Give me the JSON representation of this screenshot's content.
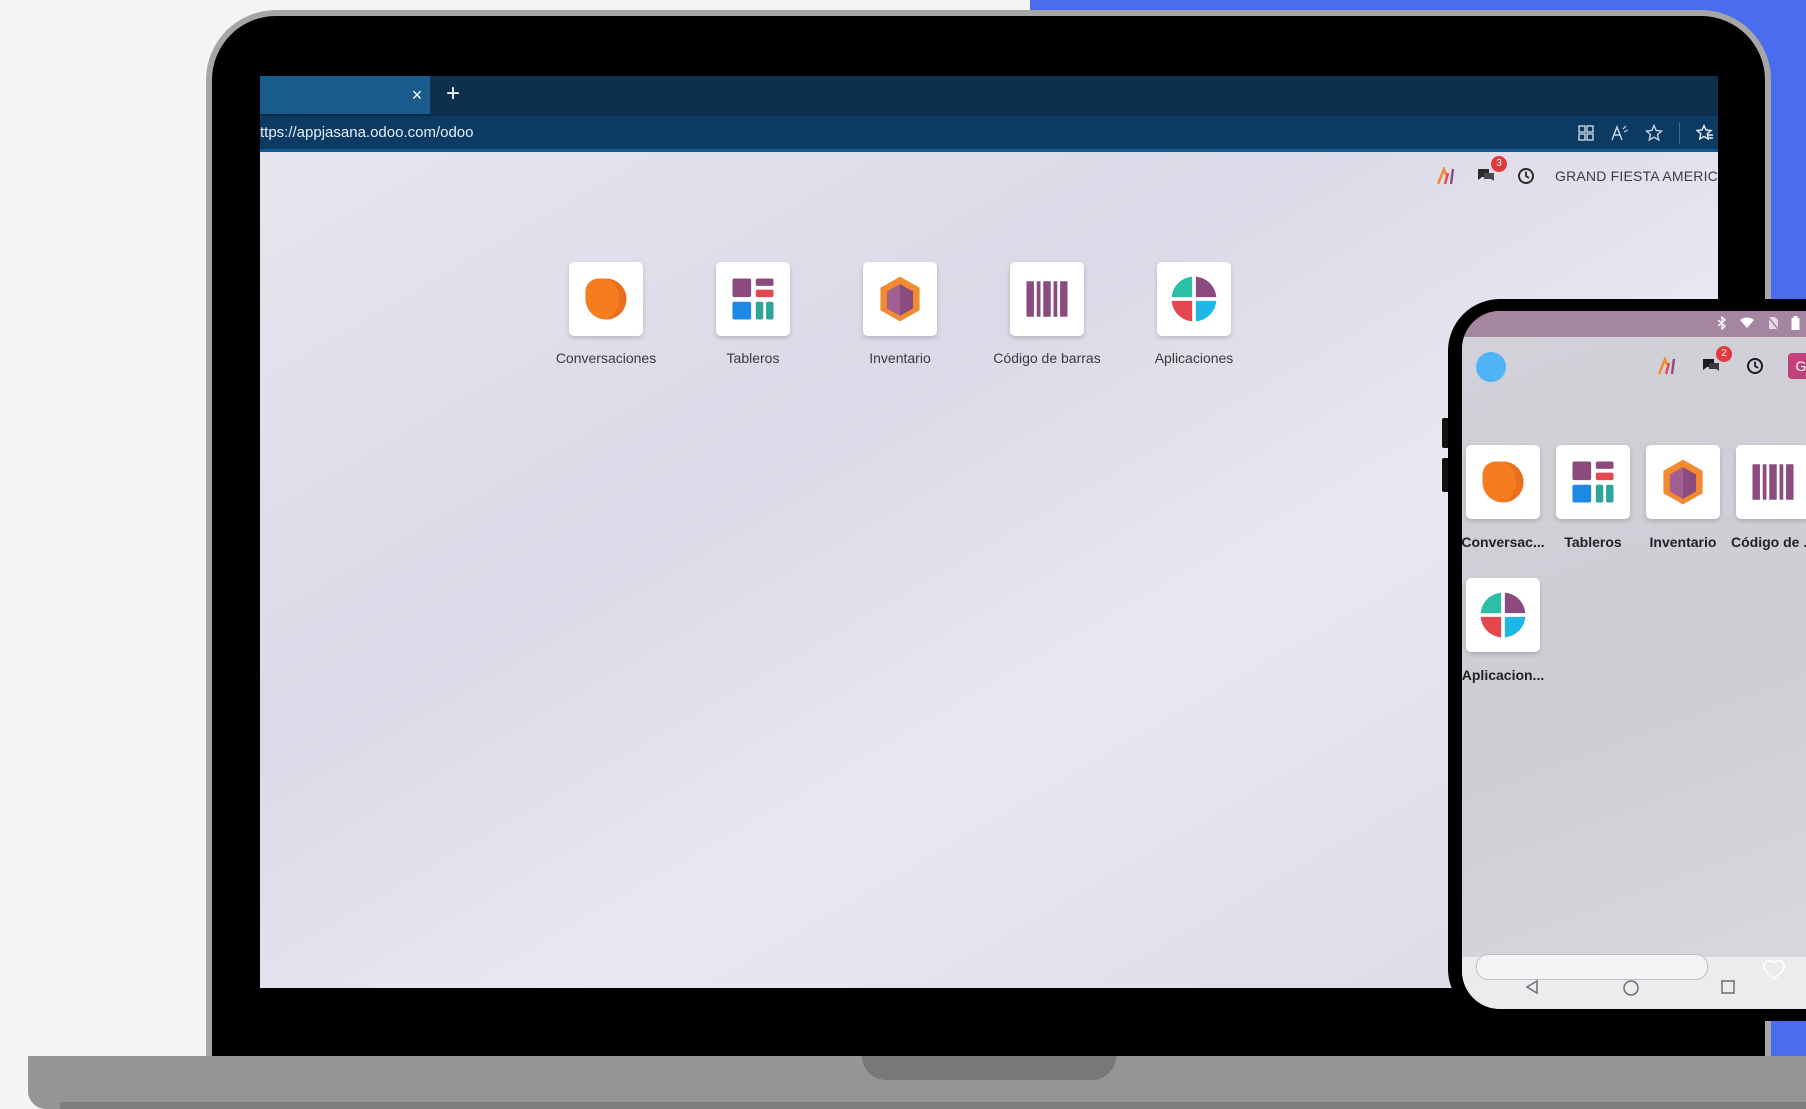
{
  "browser": {
    "tab_close": "×",
    "new_tab": "+",
    "url": "ttps://appjasana.odoo.com/odoo"
  },
  "desktop": {
    "notifications_count": "3",
    "company": "GRAND FIESTA AMERIC",
    "apps": [
      {
        "label": "Conversaciones",
        "icon": "conversaciones-icon"
      },
      {
        "label": "Tableros",
        "icon": "tableros-icon"
      },
      {
        "label": "Inventario",
        "icon": "inventario-icon"
      },
      {
        "label": "Código de barras",
        "icon": "codigo-barras-icon"
      },
      {
        "label": "Aplicaciones",
        "icon": "aplicaciones-icon"
      }
    ]
  },
  "mobile": {
    "notifications_count": "2",
    "avatar_letter": "G",
    "apps": [
      {
        "label": "Conversac...",
        "icon": "conversaciones-icon"
      },
      {
        "label": "Tableros",
        "icon": "tableros-icon"
      },
      {
        "label": "Inventario",
        "icon": "inventario-icon"
      },
      {
        "label": "Código de ...",
        "icon": "codigo-barras-icon"
      },
      {
        "label": "Aplicacion...",
        "icon": "aplicaciones-icon"
      }
    ]
  },
  "colors": {
    "accent_blue": "#4a6df0",
    "odoo_purple": "#8c4b7e",
    "badge_red": "#e03a3e"
  }
}
